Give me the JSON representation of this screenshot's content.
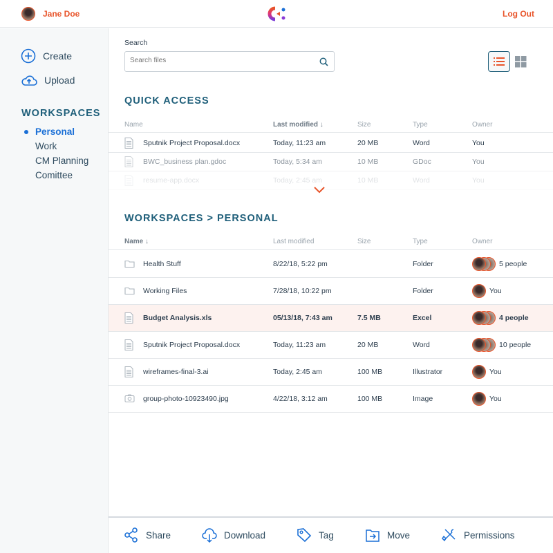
{
  "header": {
    "user_name": "Jane Doe",
    "logout_label": "Log Out",
    "accent": "#e8542a"
  },
  "sidebar": {
    "create_label": "Create",
    "upload_label": "Upload",
    "workspaces_heading": "WORKSPACES",
    "workspaces": [
      {
        "label": "Personal",
        "active": true
      },
      {
        "label": "Work"
      },
      {
        "label": "CM Planning"
      },
      {
        "label": "Comittee"
      }
    ]
  },
  "search": {
    "label": "Search",
    "placeholder": "Search files"
  },
  "view": {
    "active": "list"
  },
  "quick_access": {
    "heading": "QUICK ACCESS",
    "columns": [
      "Name",
      "Last modified ↓",
      "Size",
      "Type",
      "Owner"
    ],
    "rows": [
      {
        "name": "Sputnik Project Proposal.docx",
        "modified": "Today, 11:23 am",
        "size": "20 MB",
        "type": "Word",
        "owner": "You"
      },
      {
        "name": "BWC_business plan.gdoc",
        "modified": "Today, 5:34 am",
        "size": "10 MB",
        "type": "GDoc",
        "owner": "You"
      },
      {
        "name": "resume-app.docx",
        "modified": "Today, 2:45 am",
        "size": "10 MB",
        "type": "Word",
        "owner": "You"
      }
    ]
  },
  "workspace_files": {
    "heading": "WORKSPACES > PERSONAL",
    "columns": [
      "Name ↓",
      "Last modified",
      "Size",
      "Type",
      "Owner"
    ],
    "rows": [
      {
        "icon": "folder-icon",
        "name": "Health Stuff",
        "modified": "8/22/18, 5:22 pm",
        "size": "",
        "type": "Folder",
        "owner": "5 people",
        "avatars": 3
      },
      {
        "icon": "folder-icon",
        "name": "Working Files",
        "modified": "7/28/18, 10:22 pm",
        "size": "",
        "type": "Folder",
        "owner": "You",
        "avatars": 1
      },
      {
        "icon": "file-icon",
        "name": "Budget Analysis.xls",
        "modified": "05/13/18, 7:43 am",
        "size": "7.5 MB",
        "type": "Excel",
        "owner": "4 people",
        "avatars": 3,
        "selected": true
      },
      {
        "icon": "file-icon",
        "name": "Sputnik Project Proposal.docx",
        "modified": "Today, 11:23 am",
        "size": "20 MB",
        "type": "Word",
        "owner": "10 people",
        "avatars": 3
      },
      {
        "icon": "file-icon",
        "name": "wireframes-final-3.ai",
        "modified": "Today, 2:45 am",
        "size": "100 MB",
        "type": "Illustrator",
        "owner": "You",
        "avatars": 1
      },
      {
        "icon": "image-icon",
        "name": "group-photo-10923490.jpg",
        "modified": "4/22/18, 3:12 am",
        "size": "100 MB",
        "type": "Image",
        "owner": "You",
        "avatars": 1
      }
    ]
  },
  "actions": [
    {
      "label": "Share",
      "icon": "share-icon"
    },
    {
      "label": "Download",
      "icon": "download-icon"
    },
    {
      "label": "Tag",
      "icon": "tag-icon"
    },
    {
      "label": "Move",
      "icon": "move-icon"
    },
    {
      "label": "Permissions",
      "icon": "permissions-icon"
    }
  ]
}
